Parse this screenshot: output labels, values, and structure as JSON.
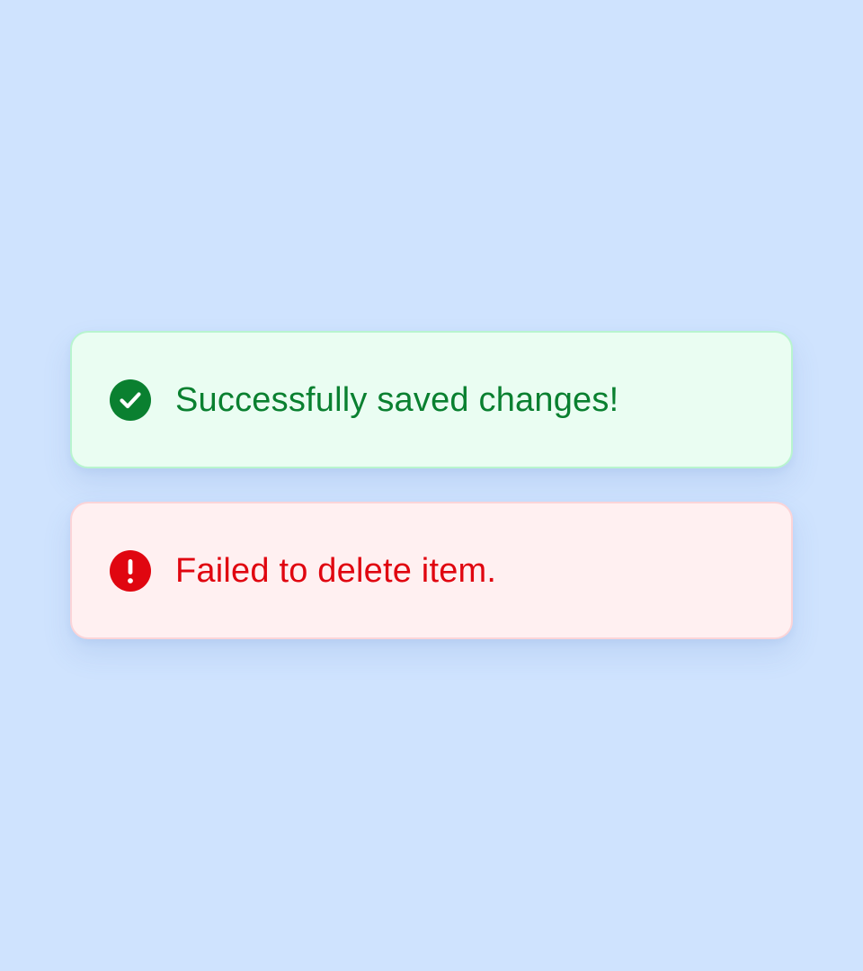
{
  "toasts": {
    "success": {
      "icon": "check-circle-icon",
      "message": "Successfully saved changes!",
      "color": "#0a8030",
      "background": "#eafdf2",
      "border": "#b8f4cf"
    },
    "error": {
      "icon": "exclamation-circle-icon",
      "message": "Failed to delete item.",
      "color": "#e00610",
      "background": "#fff0f1",
      "border": "#fbd4d8"
    }
  },
  "page": {
    "background": "#cfe3fe"
  }
}
